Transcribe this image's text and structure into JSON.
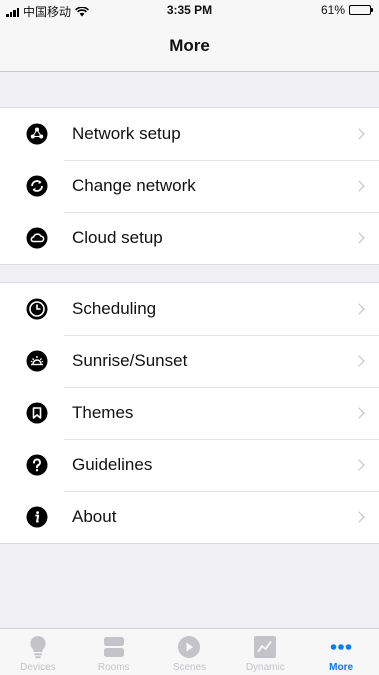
{
  "status_bar": {
    "carrier": "中国移动",
    "time": "3:35 PM",
    "battery": "61%",
    "battery_level": 0.61
  },
  "nav": {
    "title": "More"
  },
  "sections": [
    [
      {
        "label": "Network setup",
        "icon": "network-setup-icon"
      },
      {
        "label": "Change network",
        "icon": "change-network-icon"
      },
      {
        "label": "Cloud setup",
        "icon": "cloud-icon"
      }
    ],
    [
      {
        "label": "Scheduling",
        "icon": "clock-icon"
      },
      {
        "label": "Sunrise/Sunset",
        "icon": "sunrise-icon"
      },
      {
        "label": "Themes",
        "icon": "bookmark-icon"
      },
      {
        "label": "Guidelines",
        "icon": "question-icon"
      },
      {
        "label": "About",
        "icon": "info-icon"
      }
    ]
  ],
  "tabs": [
    {
      "label": "Devices",
      "icon": "lightbulb-icon"
    },
    {
      "label": "Rooms",
      "icon": "rooms-icon"
    },
    {
      "label": "Scenes",
      "icon": "play-icon"
    },
    {
      "label": "Dynamic",
      "icon": "chart-icon"
    },
    {
      "label": "More",
      "icon": "more-dots-icon",
      "active": true
    }
  ],
  "colors": {
    "accent": "#0a7cf5",
    "inactive": "#c4c4c8",
    "background": "#efeff4"
  }
}
